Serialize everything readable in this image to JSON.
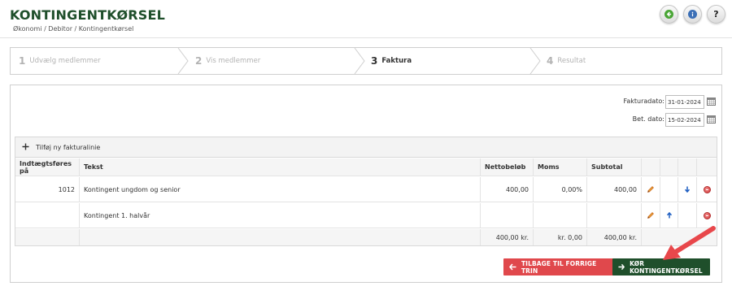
{
  "header": {
    "title": "KONTINGENTKØRSEL",
    "breadcrumb": "Økonomi / Debitor / Kontingentkørsel",
    "help_glyph": "?",
    "icons": [
      "back-arrow-icon",
      "info-icon",
      "help-icon"
    ],
    "colors": {
      "title": "#1f4f2b",
      "back": "#49a535",
      "info": "#3b6fb6"
    }
  },
  "wizard": {
    "steps": [
      {
        "num": "1",
        "label": "Udvælg medlemmer",
        "state": "inactive"
      },
      {
        "num": "2",
        "label": "Vis medlemmer",
        "state": "inactive"
      },
      {
        "num": "3",
        "label": "Faktura",
        "state": "active"
      },
      {
        "num": "4",
        "label": "Resultat",
        "state": "inactive"
      }
    ]
  },
  "dates": {
    "invoice_label": "Fakturadato:",
    "invoice_value": "31-01-2024",
    "due_label": "Bet. dato:",
    "due_value": "15-02-2024"
  },
  "table": {
    "add_label": "Tilføj ny fakturalinie",
    "columns": [
      "Indtægtsføres på",
      "Tekst",
      "Nettobeløb",
      "Moms",
      "Subtotal"
    ],
    "rows": [
      {
        "account": "1012",
        "text": "Kontingent ungdom og senior",
        "net": "400,00",
        "vat": "0,00%",
        "subtotal": "400,00",
        "move": "down"
      },
      {
        "account": "",
        "text": "Kontingent 1. halvår",
        "net": "",
        "vat": "",
        "subtotal": "",
        "move": "up"
      }
    ],
    "totals": {
      "net": "400,00 kr.",
      "vat": "kr. 0,00",
      "subtotal": "400,00 kr."
    }
  },
  "actions": {
    "back_label": "TILBAGE TIL FORRIGE TRIN",
    "run_label": "KØR KONTINGENTKØRSEL",
    "colors": {
      "back": "#e0484c",
      "run": "#1f4f2b",
      "annotation": "#e8474b"
    }
  }
}
